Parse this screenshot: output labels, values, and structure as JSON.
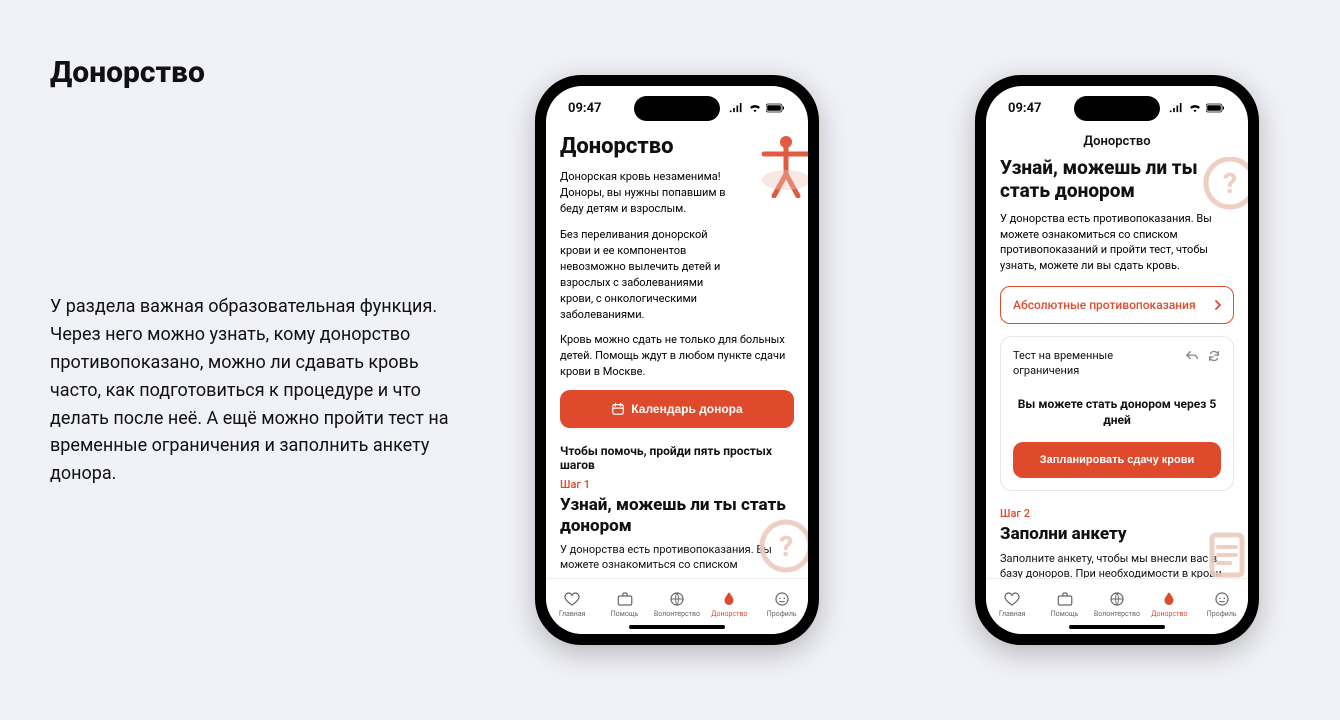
{
  "page": {
    "title": "Донорство",
    "description": "У раздела важная образовательная функция. Через него можно узнать, кому донорство противопоказано, можно ли сдавать кровь часто, как подготовиться к процедуре и что делать после неё. А ещё можно пройти тест на временные ограничения и заполнить анкету донора."
  },
  "status": {
    "time": "09:47"
  },
  "colors": {
    "accent": "#df4a2c"
  },
  "tabs": {
    "items": [
      {
        "label": "Главная",
        "icon": "heart-icon"
      },
      {
        "label": "Помощь",
        "icon": "briefcase-icon"
      },
      {
        "label": "Волонтерство",
        "icon": "globe-icon"
      },
      {
        "label": "Донорство",
        "icon": "drop-icon"
      },
      {
        "label": "Профиль",
        "icon": "face-icon"
      }
    ],
    "active_index": 3
  },
  "phone1": {
    "heading": "Донорство",
    "p1": "Донорская кровь незаменима! Доноры, вы нужны попавшим в беду детям и взрослым.",
    "p2": "Без переливания донорской крови и ее компонентов невозможно вылечить детей и взрослых с заболеваниями крови, с онкологическими заболеваниями.",
    "p3": "Кровь можно сдать не только для больных детей. Помощь ждут в любом пункте сдачи крови в Москве.",
    "cta": "Календарь донора",
    "section_title": "Чтобы помочь, пройди пять простых шагов",
    "step_label": "Шаг 1",
    "step_heading": "Узнай, можешь ли ты стать донором",
    "step_desc": "У донорства есть противопоказания. Вы можете ознакомиться со списком"
  },
  "phone2": {
    "nav_title": "Донорство",
    "heading": "Узнай, можешь ли ты стать донором",
    "intro": "У донорства есть противопоказания. Вы можете ознакомиться со списком противопоказаний и пройти тест, чтобы узнать, можете ли вы сдать кровь.",
    "outline_label": "Абсолютные противопоказания",
    "card": {
      "title": "Тест на временные ограничения",
      "result": "Вы можете стать донором через 5 дней",
      "cta": "Запланировать сдачу крови"
    },
    "step2_label": "Шаг 2",
    "step2_heading": "Заполни анкету",
    "step2_desc": "Заполните анкету, чтобы мы внесли вас в базу доноров. При необходимости в крови вашей группы, мы направим вам"
  }
}
